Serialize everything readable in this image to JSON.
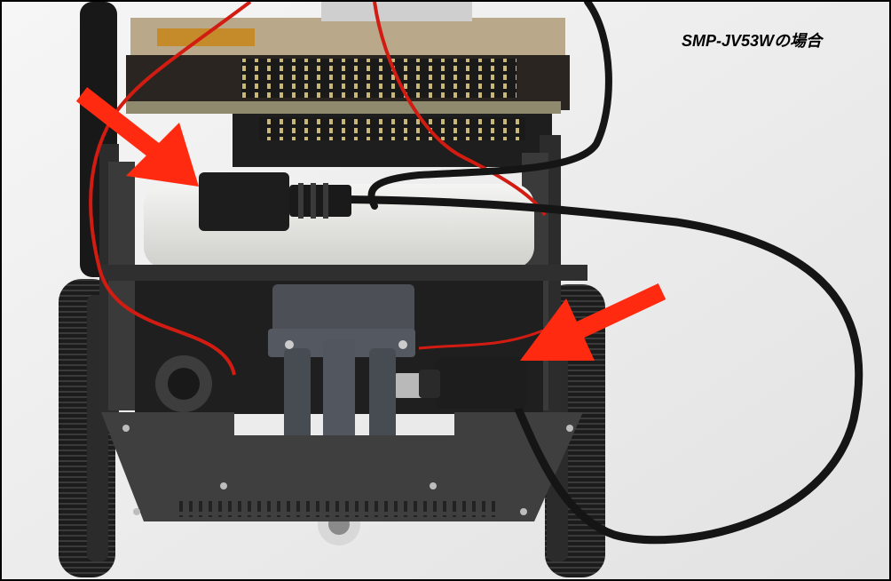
{
  "caption": "SMP-JV53Wの場合",
  "colors": {
    "background": "#eeeeee",
    "frame_border": "#000000",
    "arrow": "#ff2a10",
    "cable": "#151515",
    "red_wire": "#d21c12",
    "pcb": "#2a2520",
    "battery": "#e6e6e2",
    "chassis": "#3e3e3e",
    "wheel": "#1c1c1c"
  },
  "icons": {
    "arrow_upper": "red-arrow-icon",
    "arrow_lower": "red-arrow-icon"
  }
}
